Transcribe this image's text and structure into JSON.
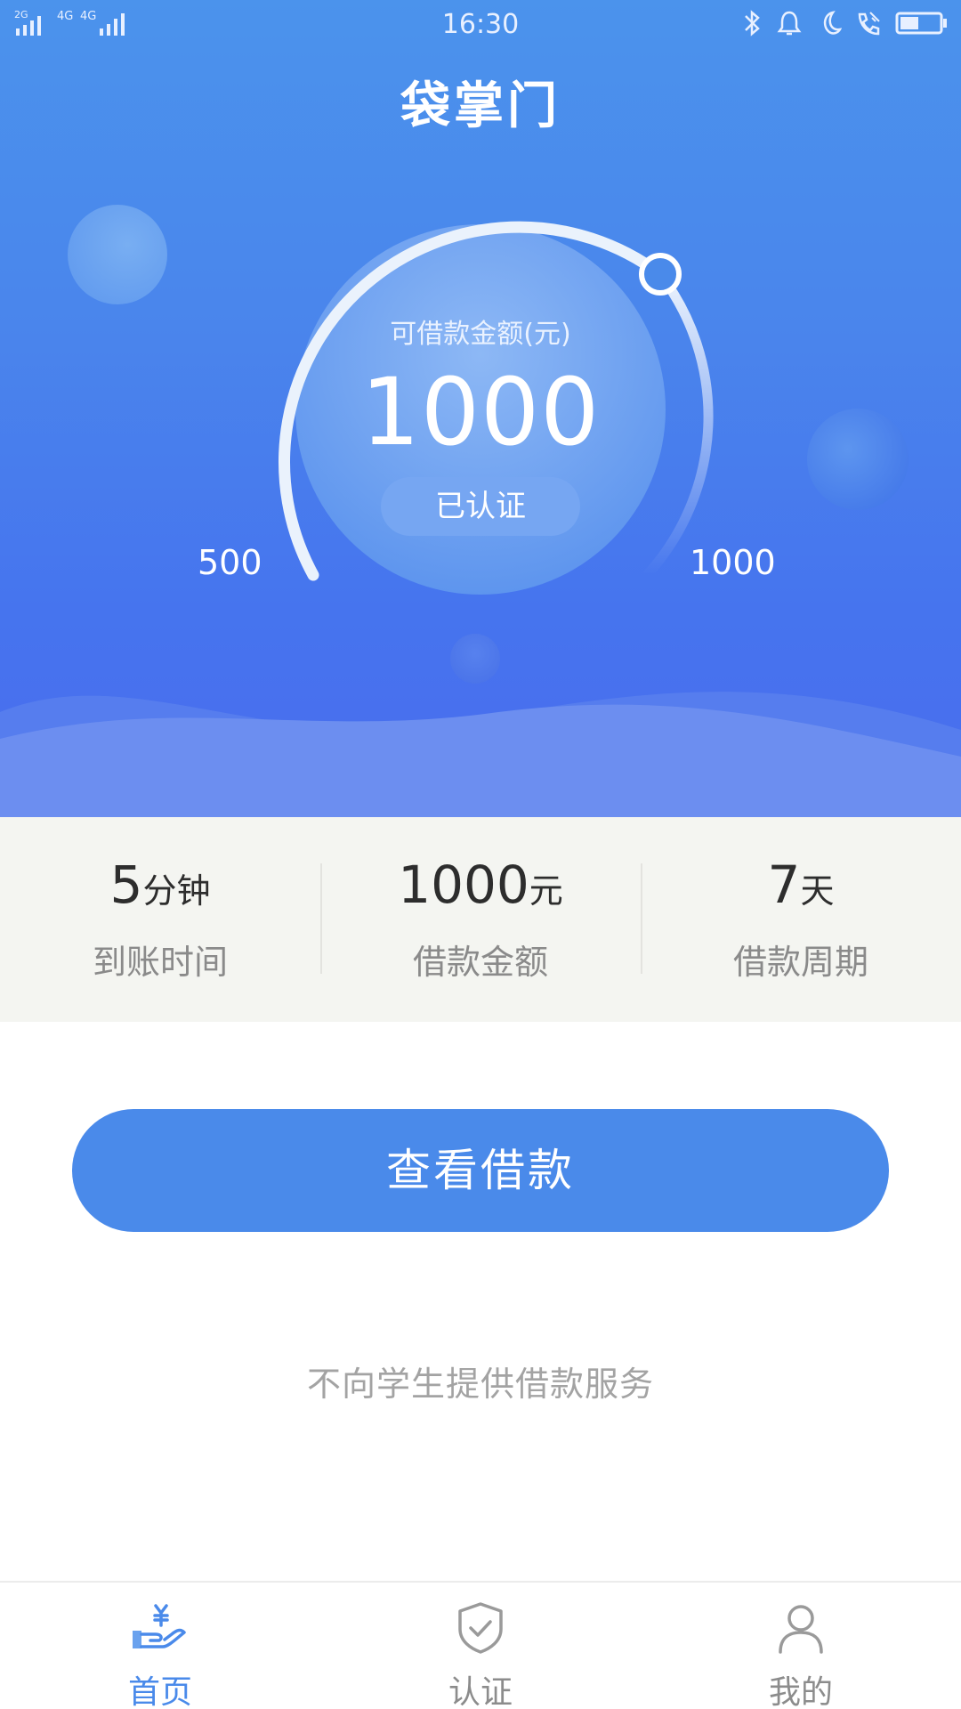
{
  "status_bar": {
    "time": "16:30",
    "network": [
      "2G",
      "4G",
      "4G"
    ],
    "icons": [
      "bluetooth-icon",
      "alarm-icon",
      "moon-icon",
      "call-icon",
      "battery-icon"
    ]
  },
  "header": {
    "title": "袋掌门"
  },
  "gauge": {
    "caption": "可借款金额(元)",
    "amount": "1000",
    "status_badge": "已认证",
    "min_label": "500",
    "max_label": "1000"
  },
  "stats": [
    {
      "value": "5",
      "unit": "分钟",
      "label": "到账时间"
    },
    {
      "value": "1000",
      "unit": "元",
      "label": "借款金额"
    },
    {
      "value": "7",
      "unit": "天",
      "label": "借款周期"
    }
  ],
  "action": {
    "button_label": "查看借款"
  },
  "disclaimer": "不向学生提供借款服务",
  "tabs": [
    {
      "label": "首页",
      "icon": "hand-yen-icon",
      "active": true
    },
    {
      "label": "认证",
      "icon": "shield-check-icon",
      "active": false
    },
    {
      "label": "我的",
      "icon": "user-icon",
      "active": false
    }
  ],
  "colors": {
    "primary": "#4a8aea",
    "hero_top": "#4b93ec",
    "hero_bottom": "#4a6ced",
    "stats_background": "#f4f5f1",
    "muted_text": "#8a8a8a"
  }
}
